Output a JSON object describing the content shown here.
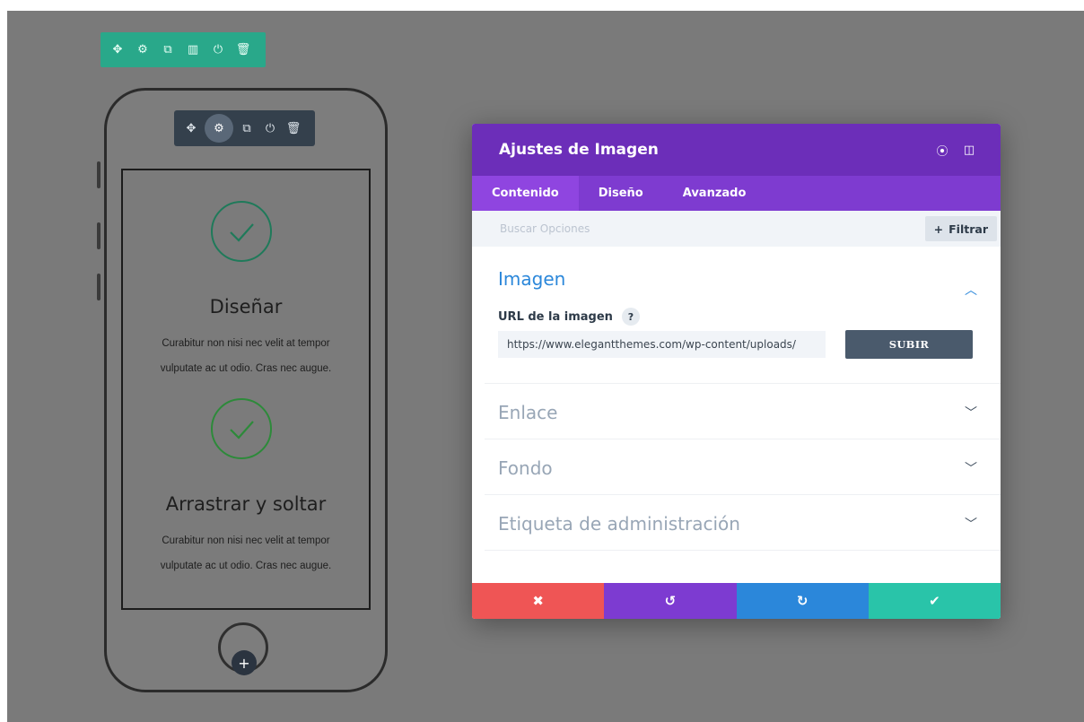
{
  "builder": {
    "row_toolbar": {
      "icons": [
        "move-icon",
        "gear-icon",
        "duplicate-icon",
        "columns-icon",
        "power-icon",
        "trash-icon"
      ],
      "color": "#29a88a"
    },
    "module_toolbar": {
      "icons": [
        "move-icon",
        "gear-icon",
        "duplicate-icon",
        "power-icon",
        "trash-icon"
      ],
      "active_icon": "gear-icon",
      "color": "#34404c"
    },
    "add_button_glyph": "+"
  },
  "phone": {
    "blurbs": [
      {
        "title": "Diseñar",
        "text": "Curabitur non nisi nec velit at tempor vulputate ac ut odio. Cras nec augue.",
        "icon": "check-circle-icon",
        "color": "#1f7a5a"
      },
      {
        "title": "Arrastrar y soltar",
        "text": "Curabitur non nisi nec velit at tempor vulputate ac ut odio. Cras nec augue.",
        "icon": "check-circle-icon",
        "color": "#2d8a3a"
      }
    ]
  },
  "modal": {
    "title": "Ajustes de Imagen",
    "header_icons": [
      "fullscreen-icon",
      "split-view-icon"
    ],
    "tabs": [
      {
        "label": "Contenido",
        "active": true
      },
      {
        "label": "Diseño",
        "active": false
      },
      {
        "label": "Avanzado",
        "active": false
      }
    ],
    "search": {
      "placeholder": "Buscar Opciones",
      "filter_label": "Filtrar",
      "filter_glyph": "+"
    },
    "sections": [
      {
        "title": "Imagen",
        "open": true,
        "field": {
          "label": "URL de la imagen",
          "help_glyph": "?",
          "value": "https://www.elegantthemes.com/wp-content/uploads/",
          "button_label": "SUBIR"
        }
      },
      {
        "title": "Enlace",
        "open": false
      },
      {
        "title": "Fondo",
        "open": false
      },
      {
        "title": "Etiqueta de administración",
        "open": false
      }
    ],
    "footer": [
      {
        "name": "cancel",
        "glyph": "✖",
        "color": "#ef5555"
      },
      {
        "name": "undo",
        "glyph": "↺",
        "color": "#7d3bd1"
      },
      {
        "name": "redo",
        "glyph": "↻",
        "color": "#2b87da"
      },
      {
        "name": "save",
        "glyph": "✔",
        "color": "#29c4a9"
      }
    ],
    "colors": {
      "header": "#6c2eb9",
      "tabs": "#7e3bd0",
      "accent": "#2b87da"
    }
  }
}
